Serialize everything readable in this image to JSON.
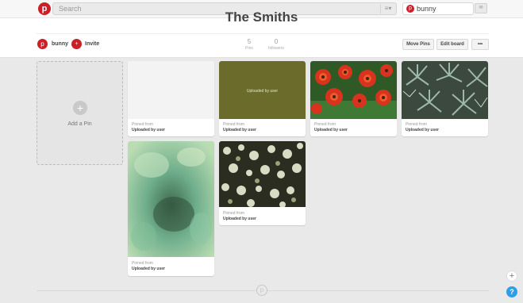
{
  "header": {
    "logo_glyph": "p",
    "search": {
      "placeholder": "Search",
      "value": ""
    },
    "menu_glyph": "≡▾",
    "user": {
      "name": "bunny",
      "avatar_glyph": "p"
    },
    "notifications_glyph": "✉"
  },
  "board": {
    "title": "The Smiths",
    "owner": {
      "name": "bunny",
      "avatar_glyph": "p"
    },
    "invite_label": "Invite",
    "invite_glyph": "+",
    "stats": [
      {
        "count": "5",
        "label": "Pins"
      },
      {
        "count": "0",
        "label": "followers"
      }
    ],
    "buttons": {
      "move_pins": "Move Pins",
      "edit_board": "Edit board",
      "more": "•••"
    }
  },
  "add_pin": {
    "label": "Add a Pin",
    "glyph": "+"
  },
  "pins": [
    {
      "from_label": "Pinned from",
      "source": "Uploaded by user",
      "image": "blank-white"
    },
    {
      "from_label": "Pinned from",
      "source": "Uploaded by user",
      "image": "olive-placeholder",
      "image_text": "Uploaded by user"
    },
    {
      "from_label": "Pinned from",
      "source": "Uploaded by user",
      "image": "red-flowers"
    },
    {
      "from_label": "Pinned from",
      "source": "Uploaded by user",
      "image": "blue-green-succulents"
    },
    {
      "from_label": "Pinned from",
      "source": "Uploaded by user",
      "image": "green-blurry-foliage"
    },
    {
      "from_label": "Pinned from",
      "source": "Uploaded by user",
      "image": "white-blossoms"
    }
  ],
  "footer": {
    "logo_glyph": "p"
  },
  "floating": {
    "add_glyph": "+",
    "help_glyph": "?"
  },
  "colors": {
    "brand_red": "#cb2027",
    "help_blue": "#2ba0e6",
    "background": "#e9e9e9"
  }
}
